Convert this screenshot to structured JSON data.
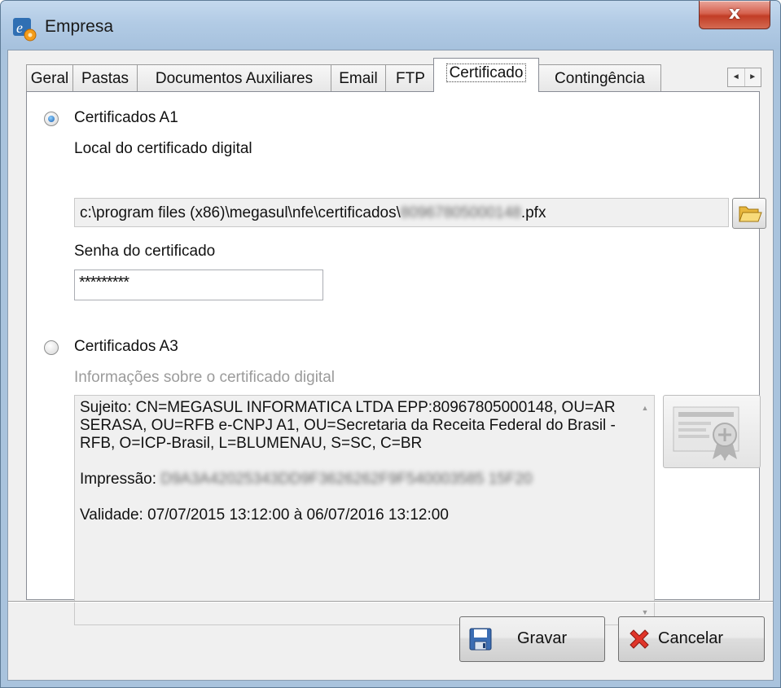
{
  "window": {
    "title": "Empresa",
    "close_glyph": "x",
    "app_icon": "e-settings-app-icon"
  },
  "tabs": [
    {
      "label": "Geral"
    },
    {
      "label": "Pastas"
    },
    {
      "label": "Documentos Auxiliares"
    },
    {
      "label": "Email"
    },
    {
      "label": "FTP"
    },
    {
      "label": "Certificado",
      "active": true
    },
    {
      "label": "Contingência"
    }
  ],
  "tab_scroll": {
    "left": "◄",
    "right": "►"
  },
  "a1": {
    "radio_label": "Certificados A1",
    "selected": true,
    "path_label": "Local do certificado digital",
    "path_value_prefix": "c:\\program files (x86)\\megasul\\nfe\\certificados\\",
    "path_value_redacted": "80967805000148",
    "path_value_suffix": ".pfx",
    "password_label": "Senha do certificado",
    "password_value": "*********"
  },
  "a3": {
    "radio_label": "Certificados A3",
    "selected": false,
    "info_label": "Informações sobre o certificado digital"
  },
  "cert_info": {
    "subject": "Sujeito: CN=MEGASUL INFORMATICA LTDA EPP:80967805000148, OU=AR SERASA, OU=RFB e-CNPJ A1, OU=Secretaria da Receita Federal do Brasil - RFB, O=ICP-Brasil, L=BLUMENAU, S=SC, C=BR",
    "thumbprint_label": "Impressão:",
    "thumbprint_redacted": "D9A3A42025343DD9F3626262F9F540003585 15F20",
    "validity": "Validade: 07/07/2015 13:12:00 à 06/07/2016 13:12:00"
  },
  "buttons": {
    "save": "Gravar",
    "cancel": "Cancelar"
  },
  "colors": {
    "title_bar": "#b2cbe5",
    "close_button": "#c9432d",
    "radio_checked": "#1b5fb0",
    "dialog_bg": "#f0f0f0"
  }
}
